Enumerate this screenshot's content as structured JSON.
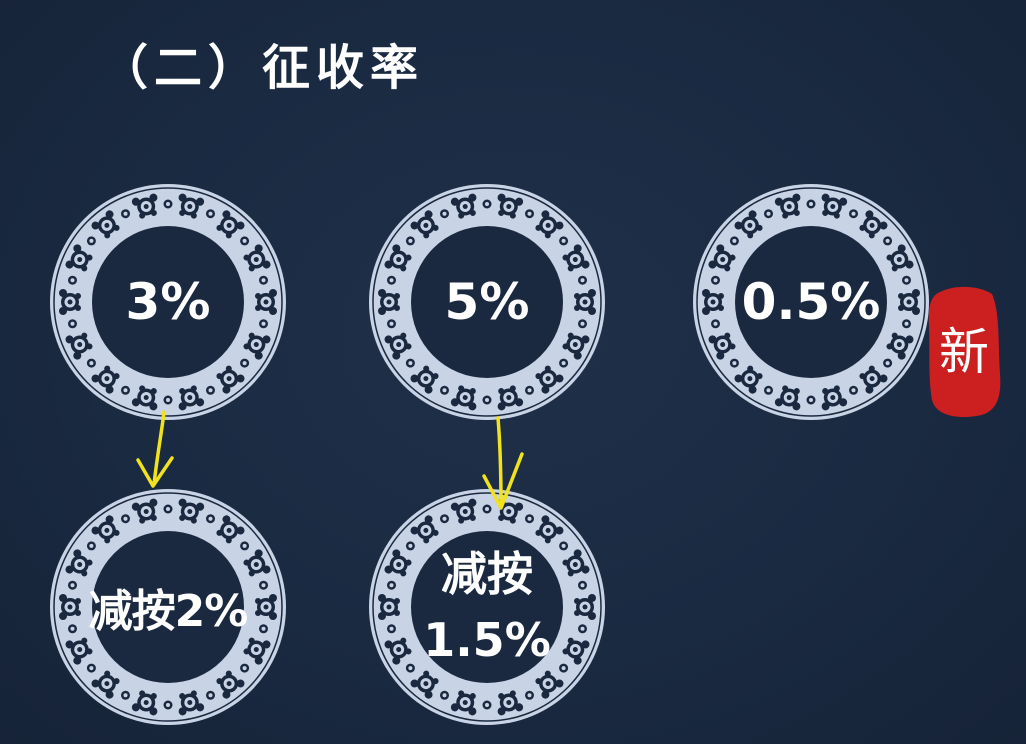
{
  "slide": {
    "title": "（二）征收率",
    "rates": [
      {
        "id": "rate-3",
        "label": "3%"
      },
      {
        "id": "rate-5",
        "label": "5%"
      },
      {
        "id": "rate-0-5",
        "label": "0.5%"
      }
    ],
    "reduced": [
      {
        "id": "reduced-2",
        "line1": "减按2%"
      },
      {
        "id": "reduced-1-5",
        "line1": "减按",
        "line2": "1.5%"
      }
    ],
    "new_badge": "新"
  },
  "colors": {
    "background": "#1b2940",
    "plate_rim": "#c9d3e6",
    "arrow": "#f2e21d",
    "seal": "#cc1f1f",
    "text": "#ffffff"
  }
}
